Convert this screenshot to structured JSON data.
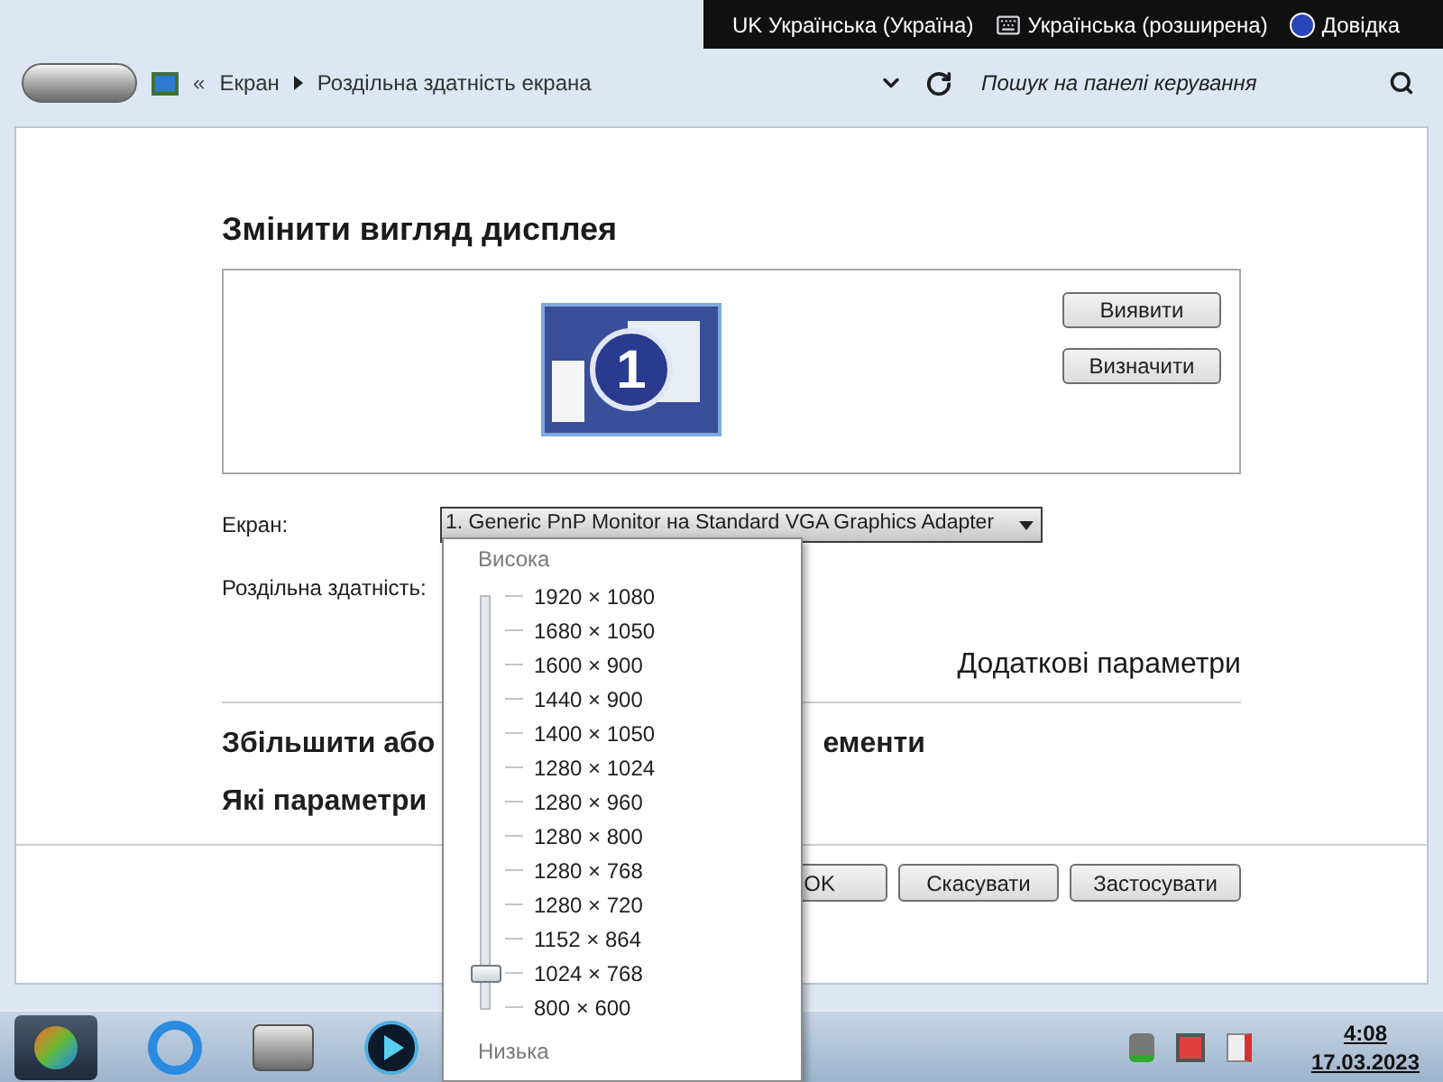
{
  "language_bar": {
    "input_language": "UK Українська (Україна)",
    "keyboard_layout": "Українська (розширена)",
    "help": "Довідка"
  },
  "address_bar": {
    "breadcrumbs": [
      "Екран",
      "Роздільна здатність екрана"
    ],
    "overflow": "«",
    "search": {
      "placeholder": "Пошук на панелі керування"
    }
  },
  "content": {
    "title": "Змінити вигляд дисплея",
    "display_number": "1",
    "buttons": [
      "Виявити",
      "Визначити"
    ],
    "screen_label": "Екран:",
    "screen_value": "1. Generic PnP Monitor на Standard VGA Graphics Adapter",
    "resolution_label": "Роздільна здатність:",
    "advanced_link": "Додаткові параметри",
    "links": [
      {
        "left": "Збільшити або",
        "right": "ементи"
      },
      {
        "left": "Які параметри"
      }
    ],
    "footer_buttons": [
      "OK",
      "Скасувати",
      "Застосувати"
    ]
  },
  "resolution_popup": {
    "high_label": "Висока",
    "low_label": "Низька",
    "level": 0.083,
    "options": [
      "1920 × 1080",
      "1680 × 1050",
      "1600 × 900",
      "1440 × 900",
      "1400 × 1050",
      "1280 × 1024",
      "1280 × 960",
      "1280 × 800",
      "1280 × 768",
      "1280 × 720",
      "1152 × 864",
      "1024 × 768",
      "800 × 600"
    ]
  },
  "taskbar": {
    "time": "4:08",
    "date": "17.03.2023"
  }
}
